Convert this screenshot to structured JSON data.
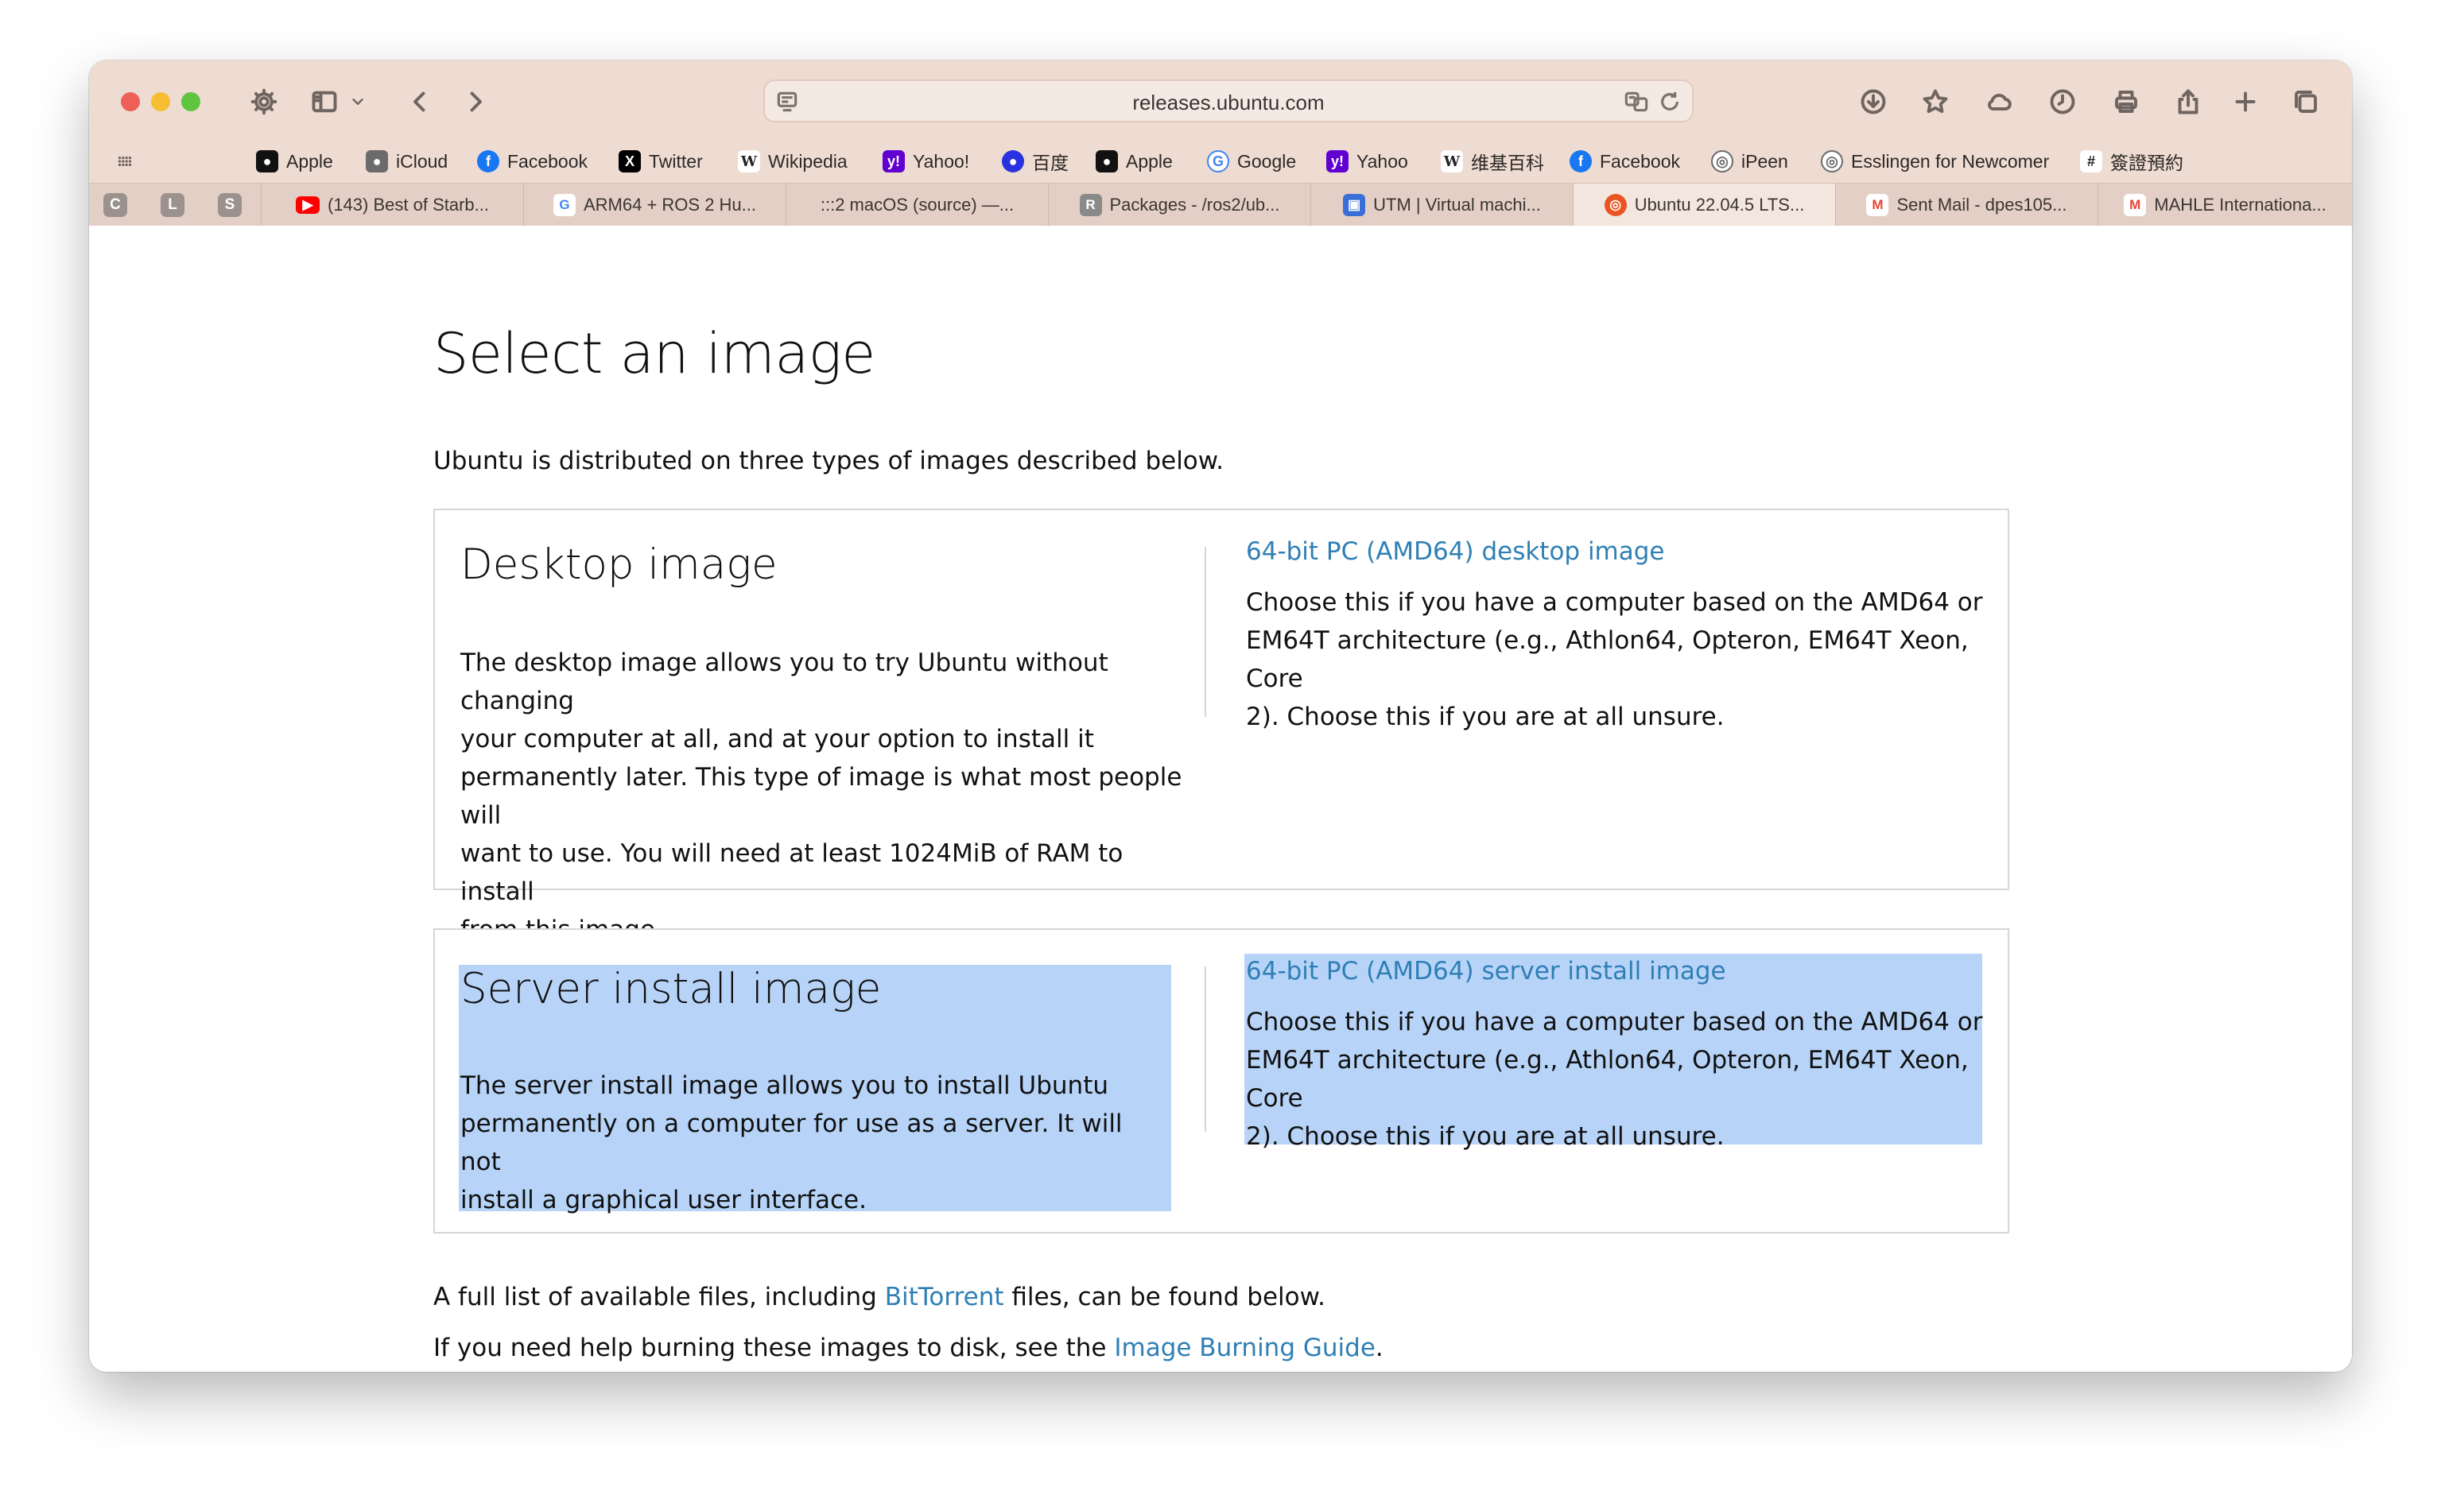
{
  "browser": {
    "url": "releases.ubuntu.com",
    "favorites": [
      {
        "label": "Apple",
        "icon": "apple-icon",
        "color": "#111111"
      },
      {
        "label": "iCloud",
        "icon": "apple-gray-icon",
        "color": "#6b6b6b"
      },
      {
        "label": "Facebook",
        "icon": "facebook-icon",
        "color": "#1877f2"
      },
      {
        "label": "Twitter",
        "icon": "x-icon",
        "color": "#000000"
      },
      {
        "label": "Wikipedia",
        "icon": "wikipedia-icon",
        "color": "#222222"
      },
      {
        "label": "Yahoo!",
        "icon": "yahoo-icon",
        "color": "#6001d2"
      },
      {
        "label": "百度",
        "icon": "baidu-icon",
        "color": "#2932e1"
      },
      {
        "label": "Apple",
        "icon": "apple-icon",
        "color": "#111111"
      },
      {
        "label": "Google",
        "icon": "google-icon",
        "color": "#4285f4"
      },
      {
        "label": "Yahoo",
        "icon": "yahoo-icon",
        "color": "#6001d2"
      },
      {
        "label": "维基百科",
        "icon": "wikipedia-icon",
        "color": "#222222"
      },
      {
        "label": "Facebook",
        "icon": "facebook-icon",
        "color": "#1877f2"
      },
      {
        "label": "iPeen",
        "icon": "globe-icon",
        "color": "#6b6b6b"
      },
      {
        "label": "Esslingen for Newcomer",
        "icon": "globe-icon",
        "color": "#6b6b6b"
      },
      {
        "label": "簽證預約",
        "icon": "visa-icon",
        "color": "#222222"
      }
    ],
    "pinned_tabs": [
      "C",
      "L",
      "S"
    ],
    "tabs": [
      {
        "label": "(143) Best of Starb...",
        "icon": "youtube-icon",
        "color": "#ff0000",
        "active": false
      },
      {
        "label": "ARM64 + ROS 2 Hu...",
        "icon": "google-icon",
        "color": "#4285f4",
        "active": false
      },
      {
        "label": ":::2 macOS (source) —...",
        "icon": "",
        "color": "",
        "active": false
      },
      {
        "label": "Packages - /ros2/ub...",
        "icon": "r-icon",
        "color": "#8a8a8a",
        "active": false
      },
      {
        "label": "UTM | Virtual machi...",
        "icon": "utm-icon",
        "color": "#3b6fd8",
        "active": false
      },
      {
        "label": "Ubuntu 22.04.5 LTS...",
        "icon": "ubuntu-icon",
        "color": "#e95420",
        "active": true
      },
      {
        "label": "Sent Mail - dpes105...",
        "icon": "gmail-icon",
        "color": "#ea4335",
        "active": false
      },
      {
        "label": "MAHLE Internationa...",
        "icon": "gmail-icon",
        "color": "#ea4335",
        "active": false
      }
    ]
  },
  "page": {
    "title": "Select an image",
    "intro": "Ubuntu is distributed on three types of images described below.",
    "desktop": {
      "heading": "Desktop image",
      "description_lines": [
        "The desktop image allows you to try Ubuntu without changing",
        "your computer at all, and at your option to install it",
        "permanently later. This type of image is what most people will",
        "want to use. You will need at least 1024MiB of RAM to install",
        "from this image."
      ],
      "link": "64-bit PC (AMD64) desktop image",
      "link_desc_lines": [
        "Choose this if you have a computer based on the AMD64 or",
        "EM64T architecture (e.g., Athlon64, Opteron, EM64T Xeon, Core",
        "2). Choose this if you are at all unsure."
      ]
    },
    "server": {
      "heading": "Server install image",
      "description_lines": [
        "The server install image allows you to install Ubuntu",
        "permanently on a computer for use as a server. It will not",
        "install a graphical user interface."
      ],
      "link": "64-bit PC (AMD64) server install image",
      "link_desc_lines": [
        "Choose this if you have a computer based on the AMD64 or",
        "EM64T architecture (e.g., Athlon64, Opteron, EM64T Xeon, Core",
        "2). Choose this if you are at all unsure."
      ]
    },
    "footer": {
      "line1_before": "A full list of available files, including ",
      "line1_link": "BitTorrent",
      "line1_after": " files, can be found below.",
      "line2_before": "If you need help burning these images to disk, see the ",
      "line2_link": "Image Burning Guide",
      "line2_after": "."
    }
  },
  "colors": {
    "link": "#2f7fb5",
    "selection": "#b7d4f8",
    "chrome": "#eedbd1"
  }
}
